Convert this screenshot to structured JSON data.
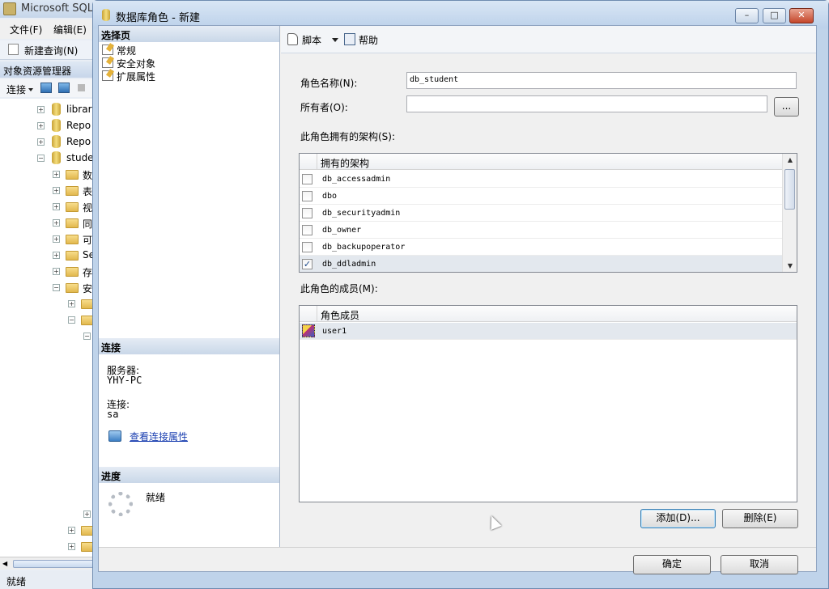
{
  "bg_app": {
    "title": "Microsoft SQL",
    "menu": [
      "文件(F)",
      "编辑(E)"
    ],
    "toolbar_new_query": "新建查询(N)",
    "oe_header": "对象资源管理器",
    "oe_connect": "连接",
    "tree": [
      "librar",
      "Repo",
      "Repo",
      "stude",
      "数",
      "表",
      "视",
      "同",
      "可",
      "Se",
      "存",
      "安"
    ],
    "status": "就绪"
  },
  "dialog": {
    "title": "数据库角色 - 新建",
    "window_buttons": {
      "minimize": "–",
      "maximize": "□",
      "close": "✕"
    }
  },
  "left_panel": {
    "select_page_header": "选择页",
    "pages": [
      "常规",
      "安全对象",
      "扩展属性"
    ],
    "connection_header": "连接",
    "server_label": "服务器:",
    "server_value": "YHY-PC",
    "connection_label": "连接:",
    "connection_value": "sa",
    "view_connection_link": "查看连接属性",
    "progress_header": "进度",
    "progress_status": "就绪"
  },
  "toolbar": {
    "script_label": "脚本",
    "help_label": "帮助"
  },
  "form": {
    "role_name_label": "角色名称(N):",
    "role_name_value": "db_student",
    "owner_label": "所有者(O):",
    "owner_value": "",
    "owner_browse": "...",
    "schemas_label": "此角色拥有的架构(S):",
    "schemas_header": "拥有的架构",
    "schemas": [
      {
        "name": "db_accessadmin",
        "checked": false
      },
      {
        "name": "dbo",
        "checked": false
      },
      {
        "name": "db_securityadmin",
        "checked": false
      },
      {
        "name": "db_owner",
        "checked": false
      },
      {
        "name": "db_backupoperator",
        "checked": false
      },
      {
        "name": "db_ddladmin",
        "checked": true
      }
    ],
    "members_label": "此角色的成员(M):",
    "members_header": "角色成员",
    "members": [
      "user1"
    ],
    "add_button": "添加(D)...",
    "remove_button": "删除(E)"
  },
  "footer": {
    "ok_button": "确定",
    "cancel_button": "取消"
  }
}
